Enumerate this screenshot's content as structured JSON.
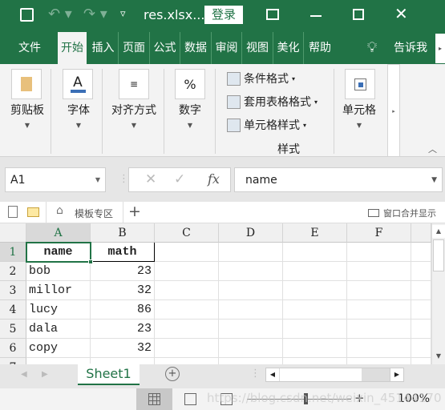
{
  "title_bar": {
    "filename": "res.xlsx...",
    "login": "登录",
    "icons": [
      "save-icon",
      "undo-icon",
      "redo-icon",
      "customize-icon",
      "ribbon-display-icon",
      "minimize-icon",
      "maximize-icon",
      "close-icon"
    ]
  },
  "ribbon_tabs": [
    "文件",
    "开始",
    "插入",
    "页面布",
    "公式",
    "数据",
    "审阅",
    "视图",
    "美化大",
    "帮助"
  ],
  "active_tab": "开始",
  "tell_me": "告诉我",
  "ribbon": {
    "clipboard": "剪贴板",
    "font": "字体",
    "alignment": "对齐方式",
    "number": "数字",
    "number_icon": "%",
    "font_icon": "A",
    "styles": {
      "items": [
        "条件格式",
        "套用表格格式",
        "单元格样式"
      ],
      "group": "样式"
    },
    "cells": "单元格"
  },
  "formula_bar": {
    "name_box": "A1",
    "fx": "fx",
    "value": "name"
  },
  "toolbar": {
    "template": "模板专区",
    "add": "+",
    "merge_window": "窗口合并显示"
  },
  "columns": [
    "A",
    "B",
    "C",
    "D",
    "E",
    "F"
  ],
  "rows": [
    {
      "n": "1",
      "a": "name",
      "b": "math"
    },
    {
      "n": "2",
      "a": "bob",
      "b": "23"
    },
    {
      "n": "3",
      "a": "millor",
      "b": "32"
    },
    {
      "n": "4",
      "a": "lucy",
      "b": "86"
    },
    {
      "n": "5",
      "a": "dala",
      "b": "23"
    },
    {
      "n": "6",
      "a": "copy",
      "b": "32"
    },
    {
      "n": "7",
      "a": "",
      "b": ""
    }
  ],
  "sheet_tab": "Sheet1",
  "status": {
    "zoom": "100%",
    "watermark": "https://blog.csdn.net/weixin_45144170"
  },
  "colors": {
    "brand": "#217346"
  }
}
